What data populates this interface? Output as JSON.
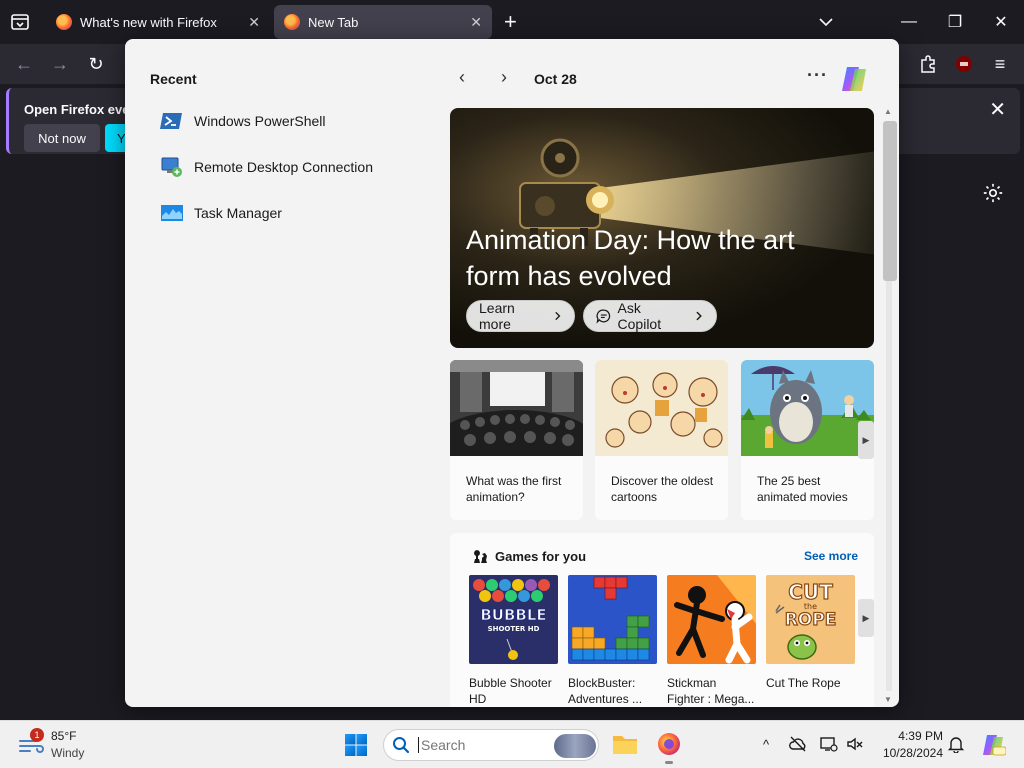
{
  "browser": {
    "tabs": [
      {
        "title": "What's new with Firefox"
      },
      {
        "title": "New Tab"
      }
    ],
    "tab_close_glyph": "✕",
    "new_tab_glyph": "+",
    "window_controls": {
      "minimize": "—",
      "maximize": "❐",
      "close": "✕"
    },
    "nav": {
      "back": "←",
      "forward": "→",
      "reload": "↻",
      "menu": "≡"
    },
    "notification": {
      "message": "Open Firefox ever",
      "not_now": "Not now",
      "yes": "Ye",
      "close": "✕"
    }
  },
  "start_menu": {
    "recent_title": "Recent",
    "recent_items": [
      {
        "label": "Windows PowerShell",
        "icon": "powershell-icon"
      },
      {
        "label": "Remote Desktop Connection",
        "icon": "remote-desktop-icon"
      },
      {
        "label": "Task Manager",
        "icon": "task-manager-icon"
      }
    ],
    "feed": {
      "prev": "‹",
      "next": "›",
      "date": "Oct 28",
      "more": "···",
      "hero": {
        "title": "Animation Day: How the art form has evolved",
        "learn_more": "Learn more",
        "ask_copilot": "Ask Copilot"
      },
      "cards": [
        {
          "caption": "What was the first animation?"
        },
        {
          "caption": "Discover the oldest cartoons"
        },
        {
          "caption": "The 25 best animated movies"
        }
      ],
      "games": {
        "title": "Games for you",
        "see_more": "See more",
        "items": [
          {
            "label": "Bubble Shooter HD",
            "line1": "Bubble Shooter",
            "line2": "HD"
          },
          {
            "label": "BlockBuster: Adventures ...",
            "line1": "BlockBuster:",
            "line2": "Adventures ..."
          },
          {
            "label": "Stickman Fighter : Mega...",
            "line1": "Stickman",
            "line2": "Fighter : Mega..."
          },
          {
            "label": "Cut The Rope",
            "line1": "Cut The Rope",
            "line2": ""
          }
        ],
        "thumb_text": {
          "bubble": "BUBBLE",
          "bubble_sub": "SHOOTER HD",
          "cut": "CUT",
          "the": "the",
          "rope": "ROPE"
        }
      },
      "scroll_up": "▲",
      "scroll_down": "▼",
      "arrow_right": "▶"
    }
  },
  "taskbar": {
    "weather": {
      "badge": "1",
      "temp": "85°F",
      "condition": "Windy"
    },
    "search_placeholder": "Search",
    "clock": {
      "time": "4:39 PM",
      "date": "10/28/2024"
    },
    "tray": {
      "chevron": "^"
    }
  }
}
